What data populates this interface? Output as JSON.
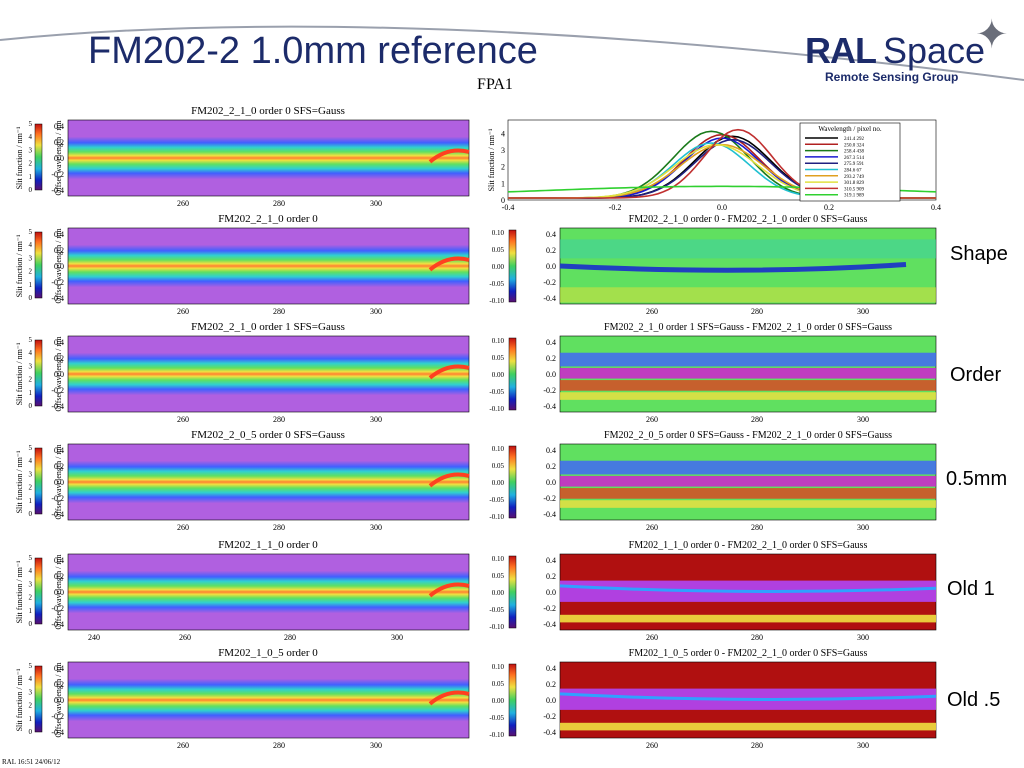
{
  "slide": {
    "title": "FM202-2 1.0mm reference",
    "fpa_label": "FPA1",
    "footer": "RAL 16:51 24/06/12",
    "logo": {
      "ral": "RAL",
      "space": "Space",
      "subtitle": "Remote Sensing Group"
    }
  },
  "chart_data": [
    {
      "type": "heatmap",
      "panel": "left-1",
      "title": "FM202_2_1_0 order 0 SFS=Gauss",
      "ylabel": "Offset wavelength / nm",
      "colorbar_label": "Slit function / nm⁻¹",
      "colorbar_ticks": [
        "0",
        "1",
        "2",
        "3",
        "4",
        "5"
      ],
      "yticks": [
        "0.4",
        "0.2",
        "0.0",
        "-0.2",
        "-0.4"
      ],
      "xticks": [
        "260",
        "280",
        "300"
      ],
      "xlim": [
        236,
        326
      ]
    },
    {
      "type": "line",
      "panel": "right-1",
      "title": "",
      "xlabel": "",
      "ylabel": "Slit function / nm⁻¹",
      "xticks": [
        "-0.4",
        "-0.2",
        "0.0",
        "0.2",
        "0.4"
      ],
      "yticks": [
        "0",
        "1",
        "2",
        "3",
        "4"
      ],
      "xlim": [
        -0.4,
        0.4
      ],
      "ylim": [
        0,
        4.8
      ],
      "legend_title": "Wavelength / pixel no.",
      "legend_position": "top-right",
      "series": [
        {
          "name": "241.4 292",
          "color": "#000000",
          "center": 0.02,
          "peak": 3.7,
          "width": 0.1
        },
        {
          "name": "250.0 324",
          "color": "#b02020",
          "center": 0.0,
          "peak": 3.8,
          "width": 0.1
        },
        {
          "name": "258.4 438",
          "color": "#1a7a1a",
          "center": -0.02,
          "peak": 4.0,
          "width": 0.1
        },
        {
          "name": "267.3 514",
          "color": "#1a1ad0",
          "center": 0.0,
          "peak": 3.6,
          "width": 0.1
        },
        {
          "name": "275.9 591",
          "color": "#202080",
          "center": 0.02,
          "peak": 3.5,
          "width": 0.1
        },
        {
          "name": "284.6 67",
          "color": "#20c0d0",
          "center": -0.02,
          "peak": 3.3,
          "width": 0.1
        },
        {
          "name": "293.2 749",
          "color": "#e0a020",
          "center": 0.0,
          "peak": 3.2,
          "width": 0.11
        },
        {
          "name": "301.8 829",
          "color": "#e0e040",
          "center": -0.01,
          "peak": 3.2,
          "width": 0.11
        },
        {
          "name": "310.5 909",
          "color": "#c03030",
          "center": 0.03,
          "peak": 4.1,
          "width": 0.09
        },
        {
          "name": "319.1 989",
          "color": "#30d030",
          "center": 0.0,
          "peak": 0.7,
          "width": 0.5
        }
      ]
    },
    {
      "type": "heatmap",
      "panel": "left-2",
      "title": "FM202_2_1_0 order 0",
      "ylabel": "Offset wavelength / nm",
      "colorbar_label": "Slit function / nm⁻¹",
      "colorbar_ticks": [
        "0",
        "1",
        "2",
        "3",
        "4",
        "5"
      ],
      "yticks": [
        "0.4",
        "0.2",
        "0.0",
        "-0.2",
        "-0.4"
      ],
      "xticks": [
        "260",
        "280",
        "300"
      ],
      "xlim": [
        236,
        326
      ]
    },
    {
      "type": "heatmap",
      "panel": "right-2",
      "title": "FM202_2_1_0 order 0 - FM202_2_1_0 order 0 SFS=Gauss",
      "row_label": "Shape",
      "colorbar_ticks": [
        "0.10",
        "0.05",
        "0.00",
        "-0.05",
        "-0.10"
      ],
      "yticks": [
        "0.4",
        "0.2",
        "0.0",
        "-0.2",
        "-0.4"
      ],
      "xticks": [
        "260",
        "280",
        "300"
      ],
      "xlim": [
        236,
        326
      ]
    },
    {
      "type": "heatmap",
      "panel": "left-3",
      "title": "FM202_2_1_0 order 1 SFS=Gauss",
      "ylabel": "Offset wavelength / nm",
      "colorbar_label": "Slit function / nm⁻¹",
      "colorbar_ticks": [
        "0",
        "1",
        "2",
        "3",
        "4",
        "5"
      ],
      "yticks": [
        "0.4",
        "0.2",
        "0.0",
        "-0.2",
        "-0.4"
      ],
      "xticks": [
        "260",
        "280",
        "300"
      ],
      "xlim": [
        236,
        326
      ]
    },
    {
      "type": "heatmap",
      "panel": "right-3",
      "title": "FM202_2_1_0 order 1 SFS=Gauss - FM202_2_1_0 order 0 SFS=Gauss",
      "row_label": "Order",
      "colorbar_ticks": [
        "0.10",
        "0.05",
        "0.00",
        "-0.05",
        "-0.10"
      ],
      "yticks": [
        "0.4",
        "0.2",
        "0.0",
        "-0.2",
        "-0.4"
      ],
      "xticks": [
        "260",
        "280",
        "300"
      ],
      "xlim": [
        236,
        326
      ]
    },
    {
      "type": "heatmap",
      "panel": "left-4",
      "title": "FM202_2_0_5 order 0 SFS=Gauss",
      "ylabel": "Offset wavelength / nm",
      "colorbar_label": "Slit function / nm⁻¹",
      "colorbar_ticks": [
        "0",
        "1",
        "2",
        "3",
        "4",
        "5"
      ],
      "yticks": [
        "0.4",
        "0.2",
        "0.0",
        "-0.2",
        "-0.4"
      ],
      "xticks": [
        "260",
        "280",
        "300"
      ],
      "xlim": [
        236,
        326
      ]
    },
    {
      "type": "heatmap",
      "panel": "right-4",
      "title": "FM202_2_0_5 order 0 SFS=Gauss - FM202_2_1_0 order 0 SFS=Gauss",
      "row_label": "0.5mm",
      "colorbar_ticks": [
        "0.10",
        "0.05",
        "0.00",
        "-0.05",
        "-0.10"
      ],
      "yticks": [
        "0.4",
        "0.2",
        "0.0",
        "-0.2",
        "-0.4"
      ],
      "xticks": [
        "260",
        "280",
        "300"
      ],
      "xlim": [
        236,
        326
      ]
    },
    {
      "type": "heatmap",
      "panel": "left-5",
      "title": "FM202_1_1_0 order 0",
      "ylabel": "Offset wavelength / nm",
      "colorbar_label": "Slit function / nm⁻¹",
      "colorbar_ticks": [
        "0",
        "1",
        "2",
        "3",
        "4",
        "5"
      ],
      "yticks": [
        "0.4",
        "0.2",
        "0.0",
        "-0.2",
        "-0.4"
      ],
      "xticks": [
        "240",
        "260",
        "280",
        "300"
      ],
      "xlim": [
        236,
        326
      ]
    },
    {
      "type": "heatmap",
      "panel": "right-5",
      "title": "FM202_1_1_0 order 0 - FM202_2_1_0 order 0 SFS=Gauss",
      "row_label": "Old 1",
      "colorbar_ticks": [
        "0.10",
        "0.05",
        "0.00",
        "-0.05",
        "-0.10"
      ],
      "yticks": [
        "0.4",
        "0.2",
        "0.0",
        "-0.2",
        "-0.4"
      ],
      "xticks": [
        "260",
        "280",
        "300"
      ],
      "xlim": [
        236,
        326
      ]
    },
    {
      "type": "heatmap",
      "panel": "left-6",
      "title": "FM202_1_0_5 order 0",
      "ylabel": "Offset wavelength / nm",
      "colorbar_label": "Slit function / nm⁻¹",
      "colorbar_ticks": [
        "0",
        "1",
        "2",
        "3",
        "4",
        "5"
      ],
      "yticks": [
        "0.4",
        "0.2",
        "0.0",
        "-0.2",
        "-0.4"
      ],
      "xticks": [
        "260",
        "280",
        "300"
      ],
      "xlim": [
        236,
        326
      ]
    },
    {
      "type": "heatmap",
      "panel": "right-6",
      "title": "FM202_1_0_5 order 0 - FM202_2_1_0 order 0 SFS=Gauss",
      "row_label": "Old .5",
      "colorbar_ticks": [
        "0.10",
        "0.05",
        "0.00",
        "-0.05",
        "-0.10"
      ],
      "yticks": [
        "0.4",
        "0.2",
        "0.0",
        "-0.2",
        "-0.4"
      ],
      "xticks": [
        "260",
        "280",
        "300"
      ],
      "xlim": [
        236,
        326
      ]
    }
  ]
}
